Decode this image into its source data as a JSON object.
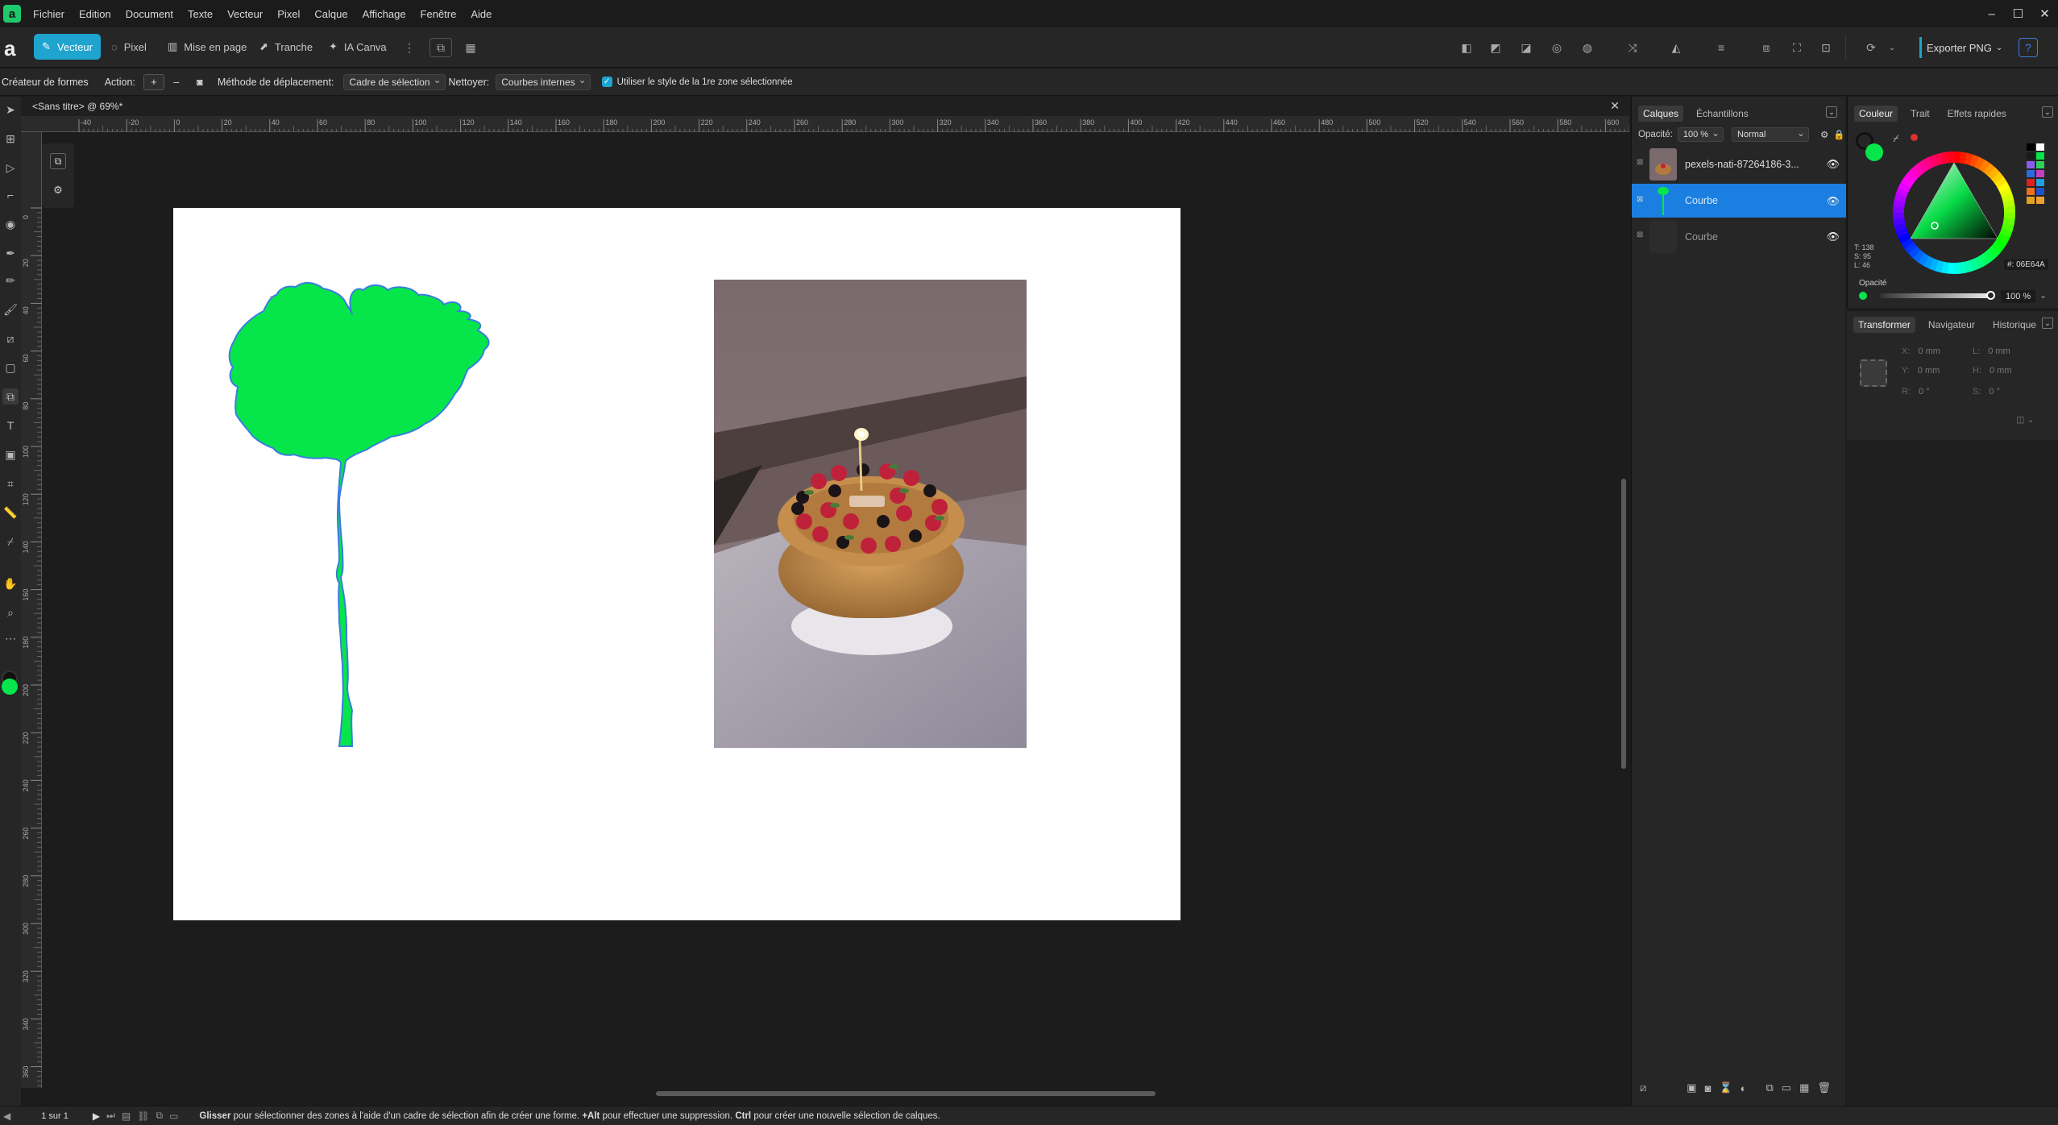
{
  "menubar": {
    "logo": "a",
    "items": [
      "Fichier",
      "Edition",
      "Document",
      "Texte",
      "Vecteur",
      "Pixel",
      "Calque",
      "Affichage",
      "Fenêtre",
      "Aide"
    ],
    "window_controls": [
      "–",
      "☐",
      "✕"
    ]
  },
  "toolbar": {
    "personas": [
      "Vecteur",
      "Pixel",
      "Mise en page",
      "Tranche",
      "IA Canva"
    ],
    "export_label": "Exporter PNG",
    "help": "?"
  },
  "context": {
    "tool_name": "Créateur de formes",
    "action_label": "Action:",
    "method_label": "Méthode de déplacement:",
    "method_value": "Cadre de sélection",
    "clean_label": "Nettoyer:",
    "clean_value": "Courbes internes",
    "use_style_label": "Utiliser le style de la 1re zone sélectionnée",
    "use_style_checked": true
  },
  "document": {
    "tab_title": "<Sans titre> @ 69%*",
    "ruler_h": [
      "-40",
      "-20",
      "0",
      "20",
      "40",
      "60",
      "80",
      "100",
      "120",
      "140",
      "160",
      "180",
      "200",
      "220",
      "240",
      "260",
      "280",
      "300",
      "320",
      "340",
      "360",
      "380",
      "400",
      "420",
      "440",
      "460",
      "480",
      "500",
      "520",
      "540",
      "560",
      "580",
      "600"
    ],
    "ruler_v": [
      "0",
      "20",
      "40",
      "60",
      "80",
      "100",
      "120",
      "140",
      "160",
      "180",
      "200",
      "220",
      "240",
      "260",
      "280",
      "300",
      "320",
      "340",
      "360"
    ]
  },
  "layers_panel": {
    "tabs": [
      "Calques",
      "Échantillons"
    ],
    "opacity_label": "Opacité:",
    "opacity_value": "100 %",
    "blend_mode": "Normal",
    "layers": [
      {
        "name": "pexels-nati-87264186-3...",
        "selected": false
      },
      {
        "name": "Courbe",
        "selected": true
      },
      {
        "name": "Courbe",
        "selected": false
      }
    ]
  },
  "color_panel": {
    "tabs": [
      "Couleur",
      "Trait",
      "Effets rapides"
    ],
    "t_value": "T: 138",
    "s_value": "S: 95",
    "l_value": "L: 46",
    "hex": "#: 06E64A",
    "opacity_label": "Opacité",
    "opacity_value": "100 %",
    "fill_color": "#06e64a"
  },
  "transform_panel": {
    "tabs": [
      "Transformer",
      "Navigateur",
      "Historique"
    ],
    "x": "0 mm",
    "y": "0 mm",
    "w": "0 mm",
    "h": "0 mm",
    "r": "0 °",
    "s": "0 °",
    "x_label": "X:",
    "y_label": "Y:",
    "w_label": "L:",
    "h_label": "H:",
    "r_label": "R:",
    "s_label": "S:"
  },
  "status": {
    "page": "1 sur 1",
    "hint_bold1": "Glisser",
    "hint1": " pour sélectionner des zones à l'aide d'un cadre de sélection afin de créer une forme. ",
    "hint_bold2": "+Alt",
    "hint2": " pour effectuer une suppression. ",
    "hint_bold3": "Ctrl",
    "hint3": " pour créer une nouvelle sélection de calques."
  },
  "colors": {
    "accent": "#1ea4cf",
    "selection": "#1a7fe0",
    "shape_fill": "#06e64a",
    "shape_stroke": "#3a7de0"
  }
}
